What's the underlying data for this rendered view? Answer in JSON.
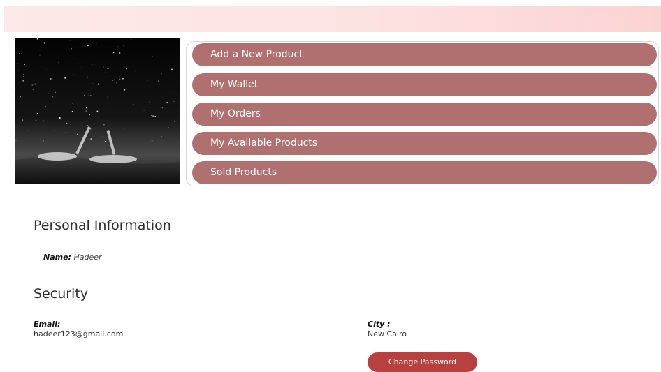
{
  "menu": {
    "items": [
      {
        "label": "Add a New Product"
      },
      {
        "label": "My Wallet"
      },
      {
        "label": "My Orders"
      },
      {
        "label": "My Available Products"
      },
      {
        "label": "Sold Products"
      }
    ]
  },
  "personal": {
    "title": "Personal Information",
    "name_label": "Name:",
    "name_value": "Hadeer"
  },
  "security": {
    "title": "Security",
    "email_label": "Email:",
    "email_value": "hadeer123@gmail.com",
    "city_label": "City :",
    "city_value": "New Cairo",
    "change_password_label": "Change Password"
  },
  "colors": {
    "menu_button": "#b0706f",
    "change_password_button": "#b8413f",
    "top_bar": "#fde2e2"
  }
}
